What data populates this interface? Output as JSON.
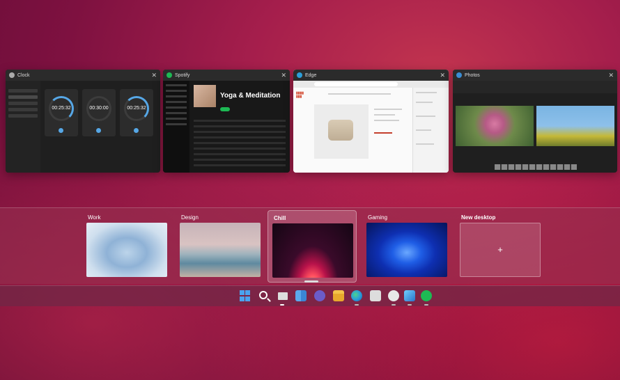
{
  "windows": [
    {
      "title": "Clock",
      "timers": [
        "00:25:32",
        "00:30:00",
        "00:25:32"
      ]
    },
    {
      "title": "Spotify",
      "heading": "Yoga & Meditation"
    },
    {
      "title": "Edge"
    },
    {
      "title": "Photos"
    }
  ],
  "desktops": [
    {
      "label": "Work",
      "active": false
    },
    {
      "label": "Design",
      "active": false
    },
    {
      "label": "Chill",
      "active": true
    },
    {
      "label": "Gaming",
      "active": false
    },
    {
      "label": "New desktop",
      "active": false,
      "plus": "+"
    }
  ],
  "taskbar": {
    "icons": [
      "windows-icon",
      "search-icon",
      "task-view-icon",
      "widgets-icon",
      "chat-icon",
      "file-explorer-icon",
      "edge-icon",
      "store-icon",
      "clock-icon",
      "photos-icon",
      "spotify-icon"
    ]
  },
  "colors": {
    "accent": "#56a7e6",
    "spotify": "#1db954"
  }
}
